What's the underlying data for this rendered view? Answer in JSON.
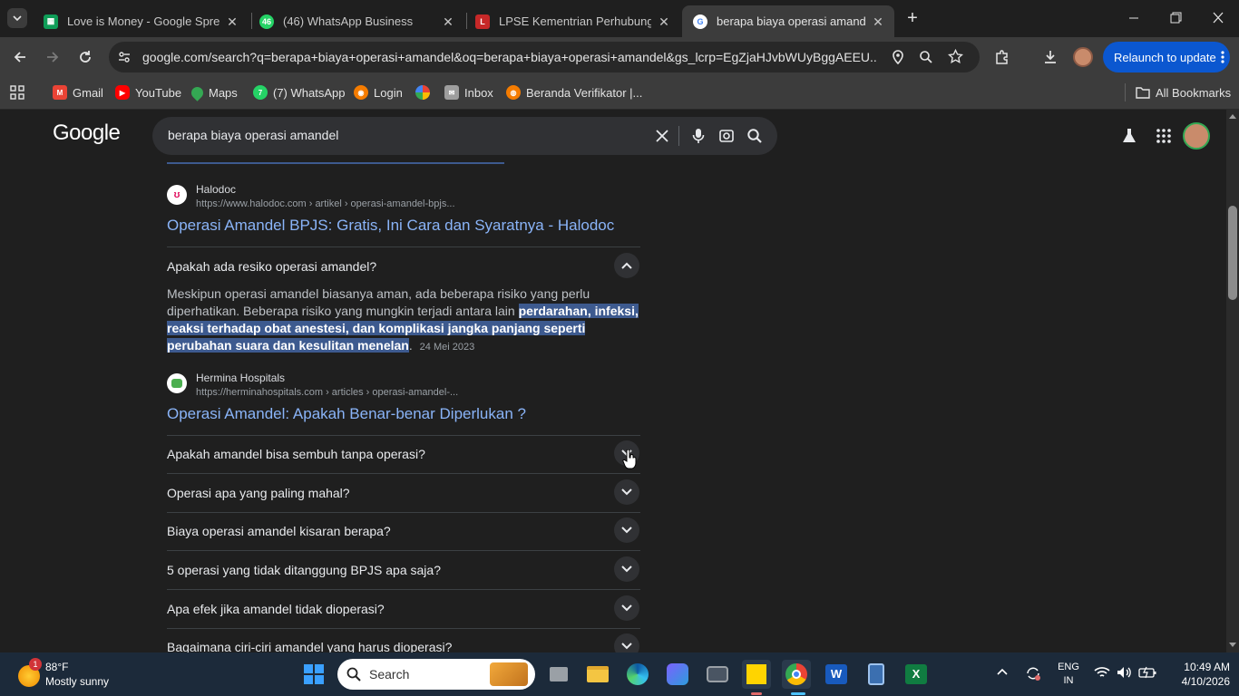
{
  "tabs": [
    {
      "title": "Love is Money - Google Spread",
      "favicon": "sheets-icon",
      "color": "#0f9d58"
    },
    {
      "title": "(46) WhatsApp Business",
      "favicon": "whatsapp-icon",
      "color": "#25d366",
      "badge": "46"
    },
    {
      "title": "LPSE Kementrian Perhubungan",
      "favicon": "lpse-icon",
      "color": "#c62828"
    },
    {
      "title": "berapa biaya operasi amandel -",
      "favicon": "google-icon",
      "color": "#4285f4"
    }
  ],
  "toolbar": {
    "url": "google.com/search?q=berapa+biaya+operasi+amandel&oq=berapa+biaya+operasi+amandel&gs_lcrp=EgZjaHJvbWUyBggAEEU...",
    "relaunch_label": "Relaunch to update"
  },
  "bookmarks": [
    {
      "label": "Gmail",
      "icon": "gmail-icon",
      "color": "#ea4335"
    },
    {
      "label": "YouTube",
      "icon": "youtube-icon",
      "color": "#ff0000"
    },
    {
      "label": "Maps",
      "icon": "maps-icon",
      "color": "#34a853"
    },
    {
      "label": "(7) WhatsApp",
      "icon": "whatsapp-icon",
      "color": "#25d366"
    },
    {
      "label": "Login",
      "icon": "login-icon",
      "color": "#f57c00"
    },
    {
      "label": "",
      "icon": "pinwheel-icon",
      "color": "#fbbc04"
    },
    {
      "label": "Inbox",
      "icon": "inbox-icon",
      "color": "#9e9e9e"
    },
    {
      "label": "Beranda Verifikator |...",
      "icon": "globe-icon",
      "color": "#f57c00"
    }
  ],
  "all_bookmarks_label": "All Bookmarks",
  "search": {
    "logo": "Google",
    "query": "berapa biaya operasi amandel"
  },
  "results": {
    "halodoc": {
      "site": "Halodoc",
      "cite": "https://www.halodoc.com › artikel › operasi-amandel-bpjs...",
      "title": "Operasi Amandel BPJS: Gratis, Ini Cara dan Syaratnya - Halodoc"
    },
    "paa_open": {
      "question": "Apakah ada resiko operasi amandel?",
      "answer_plain": "Meskipun operasi amandel biasanya aman, ada beberapa risiko yang perlu diperhatikan. Beberapa risiko yang mungkin terjadi antara lain ",
      "answer_highlight": "perdarahan, infeksi, reaksi terhadap obat anestesi, dan komplikasi jangka panjang seperti perubahan suara dan kesulitan menelan",
      "answer_end": ".",
      "date": "24 Mei 2023"
    },
    "hermina": {
      "site": "Hermina Hospitals",
      "cite": "https://herminahospitals.com › articles › operasi-amandel-...",
      "title": "Operasi Amandel: Apakah Benar-benar Diperlukan ?"
    },
    "paa_questions": [
      "Apakah amandel bisa sembuh tanpa operasi?",
      "Operasi apa yang paling mahal?",
      "Biaya operasi amandel kisaran berapa?",
      "5 operasi yang tidak ditanggung BPJS apa saja?",
      "Apa efek jika amandel tidak dioperasi?",
      "Bagaimana ciri-ciri amandel yang harus dioperasi?"
    ]
  },
  "taskbar": {
    "weather_temp": "88°F",
    "weather_desc": "Mostly sunny",
    "weather_badge": "1",
    "search_label": "Search",
    "lang1": "ENG",
    "lang2": "IN",
    "time": "10:49 AM",
    "date": "4/10/2026"
  }
}
